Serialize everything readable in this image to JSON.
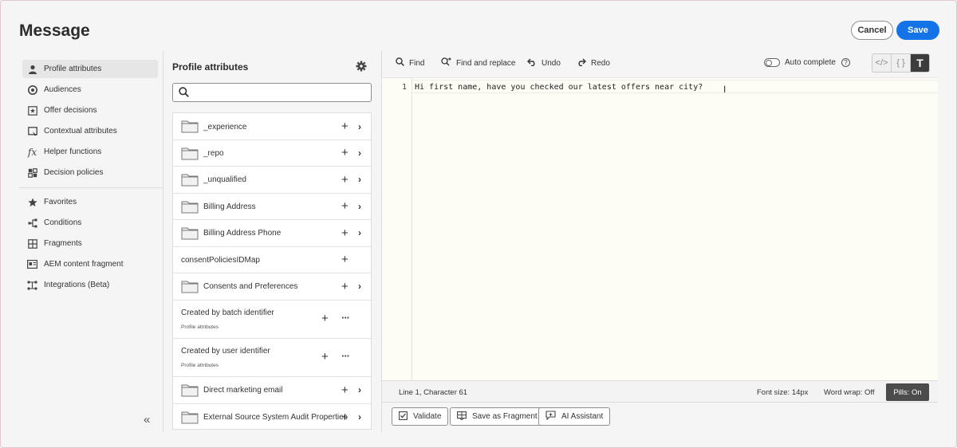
{
  "header": {
    "title": "Message",
    "cancel_label": "Cancel",
    "save_label": "Save"
  },
  "nav": {
    "items": [
      {
        "label": "Profile attributes",
        "icon": "person-icon"
      },
      {
        "label": "Audiences",
        "icon": "audiences-icon"
      },
      {
        "label": "Offer decisions",
        "icon": "offer-icon"
      },
      {
        "label": "Contextual attributes",
        "icon": "contextual-icon"
      },
      {
        "label": "Helper functions",
        "icon": "function-icon"
      },
      {
        "label": "Decision policies",
        "icon": "policy-icon"
      },
      {
        "label": "Favorites",
        "icon": "star-icon"
      },
      {
        "label": "Conditions",
        "icon": "branch-icon"
      },
      {
        "label": "Fragments",
        "icon": "fragment-icon"
      },
      {
        "label": "AEM content fragment",
        "icon": "aem-icon"
      },
      {
        "label": "Integrations (Beta)",
        "icon": "integration-icon"
      }
    ],
    "collapse_glyph": "«"
  },
  "panel": {
    "title": "Profile attributes",
    "search_placeholder": "",
    "rows": [
      {
        "label": "_experience",
        "folder": true,
        "chevron": true
      },
      {
        "label": "_repo",
        "folder": true,
        "chevron": true
      },
      {
        "label": "_unqualified",
        "folder": true,
        "chevron": true
      },
      {
        "label": "Billing Address",
        "folder": true,
        "chevron": true
      },
      {
        "label": "Billing Address Phone",
        "folder": true,
        "chevron": true
      },
      {
        "label": "consentPoliciesIDMap",
        "folder": false,
        "chevron": false
      },
      {
        "label": "Consents and Preferences",
        "folder": true,
        "chevron": true
      },
      {
        "label": "Created by batch identifier",
        "sub": "Profile attributes",
        "more": true
      },
      {
        "label": "Created by user identifier",
        "sub": "Profile attributes",
        "more": true
      },
      {
        "label": "Direct marketing email",
        "folder": true,
        "chevron": true
      },
      {
        "label": "External Source System Audit Properties",
        "folder": true,
        "chevron": true
      }
    ]
  },
  "toolbar": {
    "find": "Find",
    "find_replace": "Find and replace",
    "undo": "Undo",
    "redo": "Redo",
    "auto_complete": "Auto complete",
    "auto_complete_on": false,
    "help": "?",
    "modes": [
      "</>",
      "{ }",
      "T"
    ]
  },
  "editor": {
    "line_number": "1",
    "code": "Hi first name, have you checked our latest offers near city?"
  },
  "status": {
    "position": "Line 1, Character 61",
    "font_size": "Font size: 14px",
    "word_wrap": "Word wrap: Off",
    "pills": "Pills: On"
  },
  "actions": {
    "validate": "Validate",
    "save_fragment": "Save as Fragment",
    "ai_assistant": "AI Assistant"
  },
  "colors": {
    "accent": "#1473e6",
    "editor_bg": "#fdfdf6"
  }
}
